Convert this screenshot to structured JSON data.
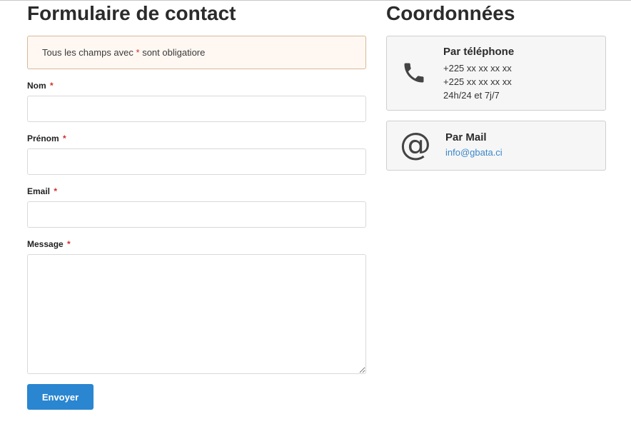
{
  "form": {
    "title": "Formulaire de contact",
    "notice_before": "Tous les champs avec ",
    "notice_star": "*",
    "notice_after": " sont obligatiore",
    "required_mark": "*",
    "fields": [
      {
        "label": "Nom",
        "value": "",
        "placeholder": ""
      },
      {
        "label": "Prénom",
        "value": "",
        "placeholder": ""
      },
      {
        "label": "Email",
        "value": "",
        "placeholder": ""
      },
      {
        "label": "Message",
        "value": "",
        "placeholder": ""
      }
    ],
    "submit_label": "Envoyer"
  },
  "contact": {
    "title": "Coordonnées",
    "phone": {
      "icon": "phone-icon",
      "title": "Par téléphone",
      "lines": [
        "+225 xx xx xx xx",
        "+225 xx xx xx xx",
        "24h/24 et 7j/7"
      ]
    },
    "mail": {
      "icon": "at-icon",
      "icon_glyph": "@",
      "title": "Par Mail",
      "email": "info@gbata.ci"
    }
  },
  "colors": {
    "accent": "#2a86d0",
    "required": "#d62b2b",
    "link": "#3a87c9",
    "notice_bg": "#fff8f2"
  }
}
